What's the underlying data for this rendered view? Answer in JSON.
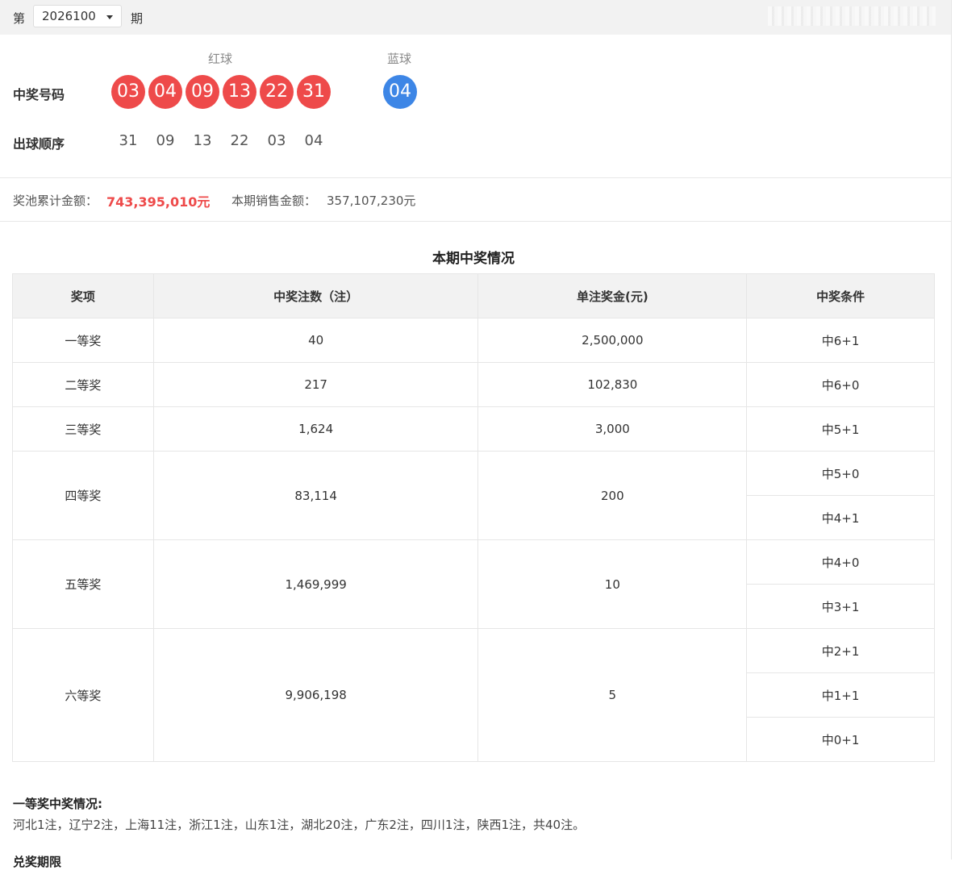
{
  "issue_bar": {
    "prefix": "第",
    "value": "2026100",
    "suffix": "期"
  },
  "balls": {
    "red_label": "红球",
    "blue_label": "蓝球",
    "winning_label": "中奖号码",
    "order_label": "出球顺序",
    "red": [
      "03",
      "04",
      "09",
      "13",
      "22",
      "31"
    ],
    "blue": [
      "04"
    ],
    "order": [
      "31",
      "09",
      "13",
      "22",
      "03",
      "04"
    ],
    "red_color": "#ee4a4a",
    "blue_color": "#3d86e6"
  },
  "pool": {
    "pool_label": "奖池累计金额：",
    "pool_value": "743,395,010元",
    "sales_label": "本期销售金额：",
    "sales_value": "357,107,230元"
  },
  "prize_table": {
    "title": "本期中奖情况",
    "headers": [
      "奖项",
      "中奖注数（注）",
      "单注奖金(元)",
      "中奖条件"
    ],
    "rows": [
      {
        "name": "一等奖",
        "count": "40",
        "amount": "2,500,000",
        "conditions": [
          "中6+1"
        ]
      },
      {
        "name": "二等奖",
        "count": "217",
        "amount": "102,830",
        "conditions": [
          "中6+0"
        ]
      },
      {
        "name": "三等奖",
        "count": "1,624",
        "amount": "3,000",
        "conditions": [
          "中5+1"
        ]
      },
      {
        "name": "四等奖",
        "count": "83,114",
        "amount": "200",
        "conditions": [
          "中5+0",
          "中4+1"
        ]
      },
      {
        "name": "五等奖",
        "count": "1,469,999",
        "amount": "10",
        "conditions": [
          "中4+0",
          "中3+1"
        ]
      },
      {
        "name": "六等奖",
        "count": "9,906,198",
        "amount": "5",
        "conditions": [
          "中2+1",
          "中1+1",
          "中0+1"
        ]
      }
    ]
  },
  "first_prize": {
    "title": "一等奖中奖情况:",
    "text": "河北1注，辽宁2注，上海11注，浙江1注，山东1注，湖北20注，广东2注，四川1注，陕西1注，共40注。"
  },
  "next_section": {
    "title": "兑奖期限"
  }
}
